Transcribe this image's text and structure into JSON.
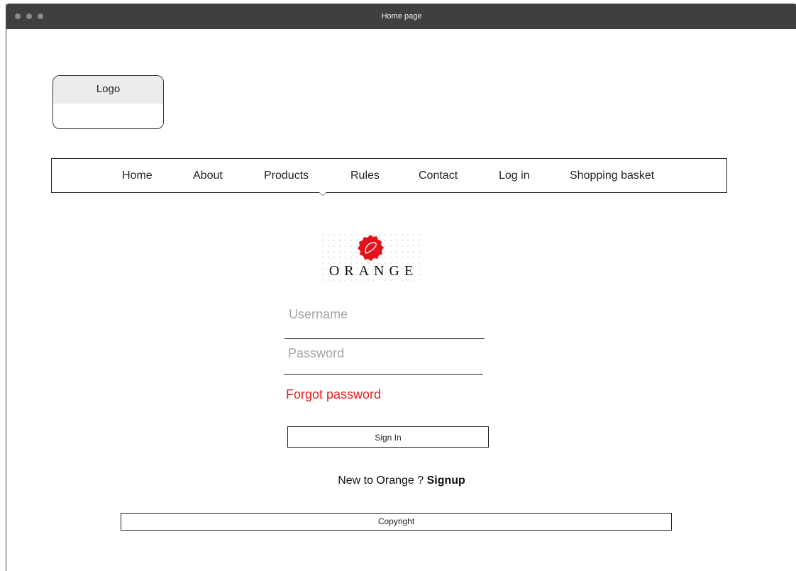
{
  "window": {
    "title": "Home page"
  },
  "logo": {
    "label": "Logo"
  },
  "nav": {
    "items": [
      {
        "label": "Home"
      },
      {
        "label": "About"
      },
      {
        "label": "Products"
      },
      {
        "label": "Rules"
      },
      {
        "label": "Contact"
      },
      {
        "label": "Log in"
      },
      {
        "label": "Shopping basket"
      }
    ]
  },
  "brand": {
    "name": "ORANGE",
    "seal_color": "#e3121b",
    "seal_icon": "brand-seal-icon"
  },
  "login": {
    "username_placeholder": "Username",
    "username_value": "",
    "password_placeholder": "Password",
    "password_value": "",
    "forgot_label": "Forgot password",
    "forgot_color": "#e02020",
    "signin_label": "Sign In"
  },
  "signup": {
    "prompt": "New to Orange ? ",
    "link_label": "Signup"
  },
  "footer": {
    "label": "Copyright"
  }
}
